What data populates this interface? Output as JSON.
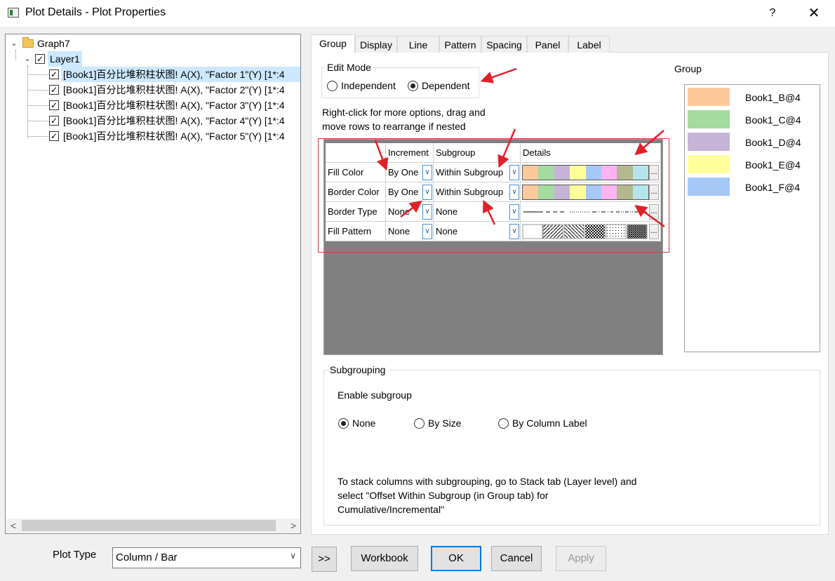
{
  "window": {
    "title": "Plot Details - Plot Properties",
    "help": "?",
    "close": "✕"
  },
  "tree": {
    "graph": "Graph7",
    "layer": "Layer1",
    "plots": [
      "[Book1]百分比堆积柱状图! A(X), \"Factor 1\"(Y) [1*:4",
      "[Book1]百分比堆积柱状图! A(X), \"Factor 2\"(Y) [1*:4",
      "[Book1]百分比堆积柱状图! A(X), \"Factor 3\"(Y) [1*:4",
      "[Book1]百分比堆积柱状图! A(X), \"Factor 4\"(Y) [1*:4",
      "[Book1]百分比堆积柱状图! A(X), \"Factor 5\"(Y) [1*:4"
    ],
    "scroll_left": "<",
    "scroll_right": ">"
  },
  "tabs": [
    "Group",
    "Display",
    "Line",
    "Pattern",
    "Spacing",
    "Panel",
    "Label"
  ],
  "edit_mode": {
    "title": "Edit Mode",
    "independent": "Independent",
    "dependent": "Dependent",
    "selected": "Dependent"
  },
  "hint": {
    "line1": "Right-click for more options, drag and",
    "line2": "move rows to  rearrange if nested"
  },
  "grid": {
    "headers": [
      "",
      "Increment",
      "Subgroup",
      "Details"
    ],
    "rows": [
      {
        "name": "Fill Color",
        "increment": "By One",
        "subgroup": "Within Subgroup"
      },
      {
        "name": "Border Color",
        "increment": "By One",
        "subgroup": "Within Subgroup"
      },
      {
        "name": "Border Type",
        "increment": "None",
        "subgroup": "None"
      },
      {
        "name": "Fill Pattern",
        "increment": "None",
        "subgroup": "None"
      }
    ],
    "palette": [
      "#fdc99b",
      "#a3dba0",
      "#c5b3d8",
      "#ffff9c",
      "#a6c8f7",
      "#ffb3f2",
      "#b3b88e",
      "#b4e4ec"
    ],
    "ellipsis": "..."
  },
  "group_panel": {
    "title": "Group",
    "items": [
      {
        "label": "Book1_B@4",
        "color": "#fdc99b"
      },
      {
        "label": "Book1_C@4",
        "color": "#a3dba0"
      },
      {
        "label": "Book1_D@4",
        "color": "#c5b3d8"
      },
      {
        "label": "Book1_E@4",
        "color": "#ffff9c"
      },
      {
        "label": "Book1_F@4",
        "color": "#a6c8f7"
      }
    ]
  },
  "subgrouping": {
    "title": "Subgrouping",
    "enable_label": "Enable subgroup",
    "options": [
      "None",
      "By Size",
      "By Column Label"
    ],
    "selected": "None",
    "note_line1": "To stack columns with subgrouping, go to Stack tab (Layer level) and",
    "note_line2": "select \"Offset Within Subgroup (in Group tab) for",
    "note_line3": "Cumulative/Incremental\""
  },
  "bottom": {
    "plot_type_label": "Plot Type",
    "plot_type_value": "Column / Bar",
    "expand": ">>",
    "workbook": "Workbook",
    "ok": "OK",
    "cancel": "Cancel",
    "apply": "Apply"
  },
  "colors": {
    "selection": "#cce8ff",
    "accent": "#0078d7",
    "annotation_red": "#e0202a"
  }
}
